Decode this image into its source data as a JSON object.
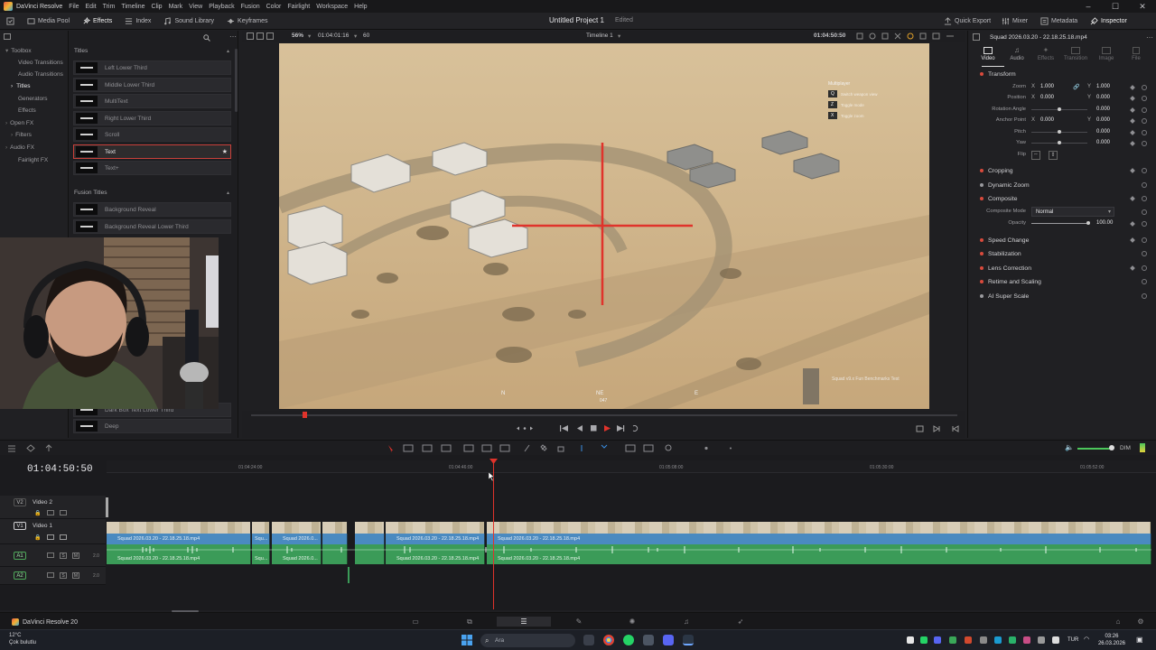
{
  "app": {
    "name": "DaVinci Resolve",
    "menu": [
      "File",
      "Edit",
      "Trim",
      "Timeline",
      "Clip",
      "Mark",
      "View",
      "Playback",
      "Fusion",
      "Color",
      "Fairlight",
      "Workspace",
      "Help"
    ]
  },
  "toolbar": {
    "items": [
      "Media Pool",
      "Effects",
      "Index",
      "Sound Library",
      "Keyframes"
    ],
    "project_title": "Untitled Project 1",
    "project_status": "Edited",
    "right_items": [
      "Quick Export",
      "Mixer",
      "Metadata",
      "Inspector"
    ]
  },
  "toolbox": {
    "items": [
      "Toolbox",
      "Video Transitions",
      "Audio Transitions",
      "Titles",
      "Generators",
      "Effects",
      "Open FX",
      "Filters",
      "Audio FX",
      "Fairlight FX"
    ],
    "selected": "Titles"
  },
  "titles_panel": {
    "header": "Titles",
    "titles": [
      "Left Lower Third",
      "Middle Lower Third",
      "MultiText",
      "Right Lower Third",
      "Scroll",
      "Text",
      "Text+"
    ],
    "selected": "Text",
    "fusion_header": "Fusion Titles",
    "fusion_titles": [
      "Background Reveal",
      "Background Reveal Lower Third"
    ],
    "bottom_titles": [
      "Dark Box Text Lower Third",
      "Deep"
    ]
  },
  "viewer": {
    "zoom": "56%",
    "source_timecode": "01:04:01:16",
    "frame_field": "60",
    "timeline_name": "Timeline 1",
    "record_timecode": "01:04:50:50",
    "game_hud": [
      "Q",
      "Z",
      "X"
    ],
    "game_hud_title": "Multiplayer",
    "game_hud_lines": [
      "Switch weapon view",
      "Toggle mode",
      "Toggle zoom"
    ],
    "compass": [
      "N",
      "NE",
      "E",
      "047"
    ],
    "watermark": "Squad v9.x Fun Benchmarks Test"
  },
  "inspector": {
    "clip_name": "Squad 2026.03.20 - 22.18.25.18.mp4",
    "tabs": [
      "Video",
      "Audio",
      "Effects",
      "Transition",
      "Image",
      "File"
    ],
    "active_tab": "Video",
    "sections": [
      "Transform",
      "Cropping",
      "Dynamic Zoom",
      "Composite",
      "Speed Change",
      "Stabilization",
      "Lens Correction",
      "Retime and Scaling",
      "AI Super Scale"
    ],
    "transform": {
      "zoom_label": "Zoom",
      "zoom_x": "1.000",
      "zoom_y": "1.000",
      "position_label": "Position",
      "position_x": "0.000",
      "position_y": "0.000",
      "rotation_label": "Rotation Angle",
      "rotation": "0.000",
      "anchor_label": "Anchor Point",
      "anchor_x": "0.000",
      "anchor_y": "0.000",
      "pitch_label": "Pitch",
      "pitch": "0.000",
      "yaw_label": "Yaw",
      "yaw": "0.000",
      "flip_label": "Flip",
      "x": "X",
      "y": "Y"
    },
    "composite": {
      "mode_label": "Composite Mode",
      "mode": "Normal",
      "opacity_label": "Opacity",
      "opacity": "100.00"
    }
  },
  "timeline": {
    "timecode": "01:04:50:50",
    "ruler": [
      "01:04:24:00",
      "01:04:46:00",
      "01:05:08:00",
      "01:05:30:00",
      "01:05:52:00"
    ],
    "tracks": [
      {
        "id": "V2",
        "name": "Video 2"
      },
      {
        "id": "V1",
        "name": "Video 1"
      },
      {
        "id": "A1",
        "name": "",
        "level": "2.0"
      },
      {
        "id": "A2",
        "name": "",
        "level": "2.0"
      }
    ],
    "clip_label": "Squad 2026.03.20 - 22.18.25.18.mp4",
    "short_labels": [
      "Squ...",
      "Squad 2026.0...",
      ""
    ],
    "dim_label": "DIM"
  },
  "pagenav": {
    "brand": "DaVinci Resolve 20"
  },
  "taskbar": {
    "temperature": "12°C",
    "weather": "Çok bulutlu",
    "search_placeholder": "Ara",
    "language": "TUR",
    "time": "03:26",
    "date": "26.03.2026"
  }
}
